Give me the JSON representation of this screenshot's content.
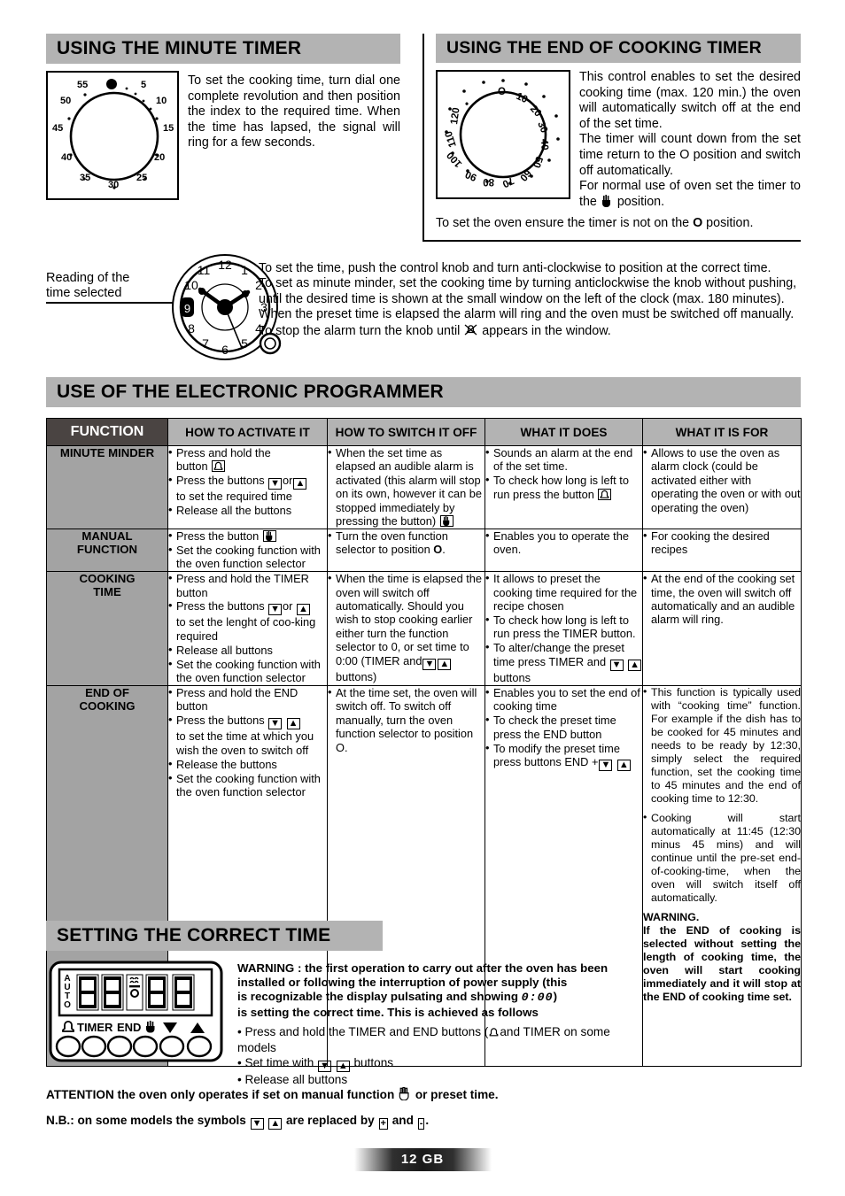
{
  "sections": {
    "minute_timer": {
      "title": "USING THE MINUTE TIMER",
      "text": "To set the cooking time, turn dial one complete revolution and then position the index to the required time. When the time has lapsed, the signal will ring for a few seconds.",
      "dial_labels": [
        "5",
        "10",
        "15",
        "20",
        "25",
        "30",
        "35",
        "40",
        "45",
        "50",
        "55"
      ]
    },
    "end_of_cooking_timer": {
      "title": "USING THE END OF COOKING TIMER",
      "paragraphs": [
        "This control enables to set the desired cooking time (max. 120 min.) the oven will automatically switch off at the end of the set time.",
        "The timer will count down from the set time return to the O position and switch off automatically.",
        "For normal use of oven set the timer to the \u0001 position."
      ],
      "p3_prefix": "For normal use of oven set the timer to",
      "p3_mid": "the",
      "p3_suffix": "position.",
      "footer_note_a": "To set the oven ensure the timer is not on the ",
      "footer_note_o": "O",
      "footer_note_b": " position.",
      "dial_labels": [
        "O",
        "10",
        "20",
        "30",
        "40",
        "50",
        "60",
        "70",
        "80",
        "90",
        "100",
        "110",
        "120"
      ]
    },
    "clock": {
      "caption_line1": "Reading of the",
      "caption_line2": "time selected",
      "numerals": [
        "12",
        "1",
        "2",
        "3",
        "4",
        "5",
        "6",
        "7",
        "8",
        "9",
        "10",
        "11"
      ],
      "window_value": "9",
      "lines": [
        "To set the time, push the control knob and turn anti-clockwise to position at the correct time.",
        "To set as minute minder, set the cooking time by turning anticlockwise the knob without pushing,",
        "until the desired time is shown at the small window on the left of the clock (max. 180 minutes).",
        "When the preset time is elapsed the alarm will ring and the oven must be switched off manually."
      ],
      "last_line_a": "To stop the alarm turn the knob until",
      "last_line_b": "appears in the window."
    }
  },
  "programmer": {
    "title": "USE OF THE ELECTRONIC PROGRAMMER",
    "columns": [
      "FUNCTION",
      "HOW TO ACTIVATE IT",
      "HOW TO SWITCH IT OFF",
      "WHAT IT DOES",
      "WHAT IT IS FOR"
    ],
    "rows": [
      {
        "name": "MINUTE MINDER",
        "activate": [
          "Press and hold the button ⌂",
          "Press the buttons ▼ or ▲ to set the required time",
          "Release all the buttons"
        ],
        "activate_parts": [
          [
            "Press and hold the",
            "button",
            "BELL"
          ],
          [
            "Press the buttons",
            "DOWN",
            "or",
            "UP",
            "to set the required time"
          ],
          [
            "Release all the buttons"
          ]
        ],
        "switch_off": [
          "When the set time as elapsed an audible alarm is activated (this alarm will stop on its own, however it can be stopped immediately by pressing the button) ✋"
        ],
        "does": [
          "Sounds an alarm at the end of the set time.",
          "To check how long is left to run press the button ⌂"
        ],
        "for": [
          "Allows to use the oven as alarm clock (could be activated either with operating the oven or with out operating the oven)"
        ]
      },
      {
        "name": "MANUAL FUNCTION",
        "name_line1": "MANUAL",
        "name_line2": "FUNCTION",
        "activate": [
          "Press the button ✋",
          "Set the cooking function with the oven function selector"
        ],
        "switch_off": [
          "Turn the oven function selector to position O."
        ],
        "does": [
          "Enables you to operate the oven."
        ],
        "for": [
          "For cooking the desired recipes"
        ]
      },
      {
        "name": "COOKING TIME",
        "name_line1": "COOKING",
        "name_line2": "TIME",
        "activate": [
          "Press and hold the TIMER button",
          "Press the buttons ▼ or ▲ to set the lenght of coo-king required",
          "Release all buttons",
          "Set the cooking function with the oven function selector"
        ],
        "switch_off": [
          "When the time is elapsed the oven will switch off automatically. Should you wish to stop cooking earlier either turn the function selector to 0, or set time to 0:00 (TIMER and ▼ ▲ buttons)"
        ],
        "does": [
          "It allows to preset the cooking time required for the recipe chosen",
          "To check how long is left to run press the TIMER button.",
          "To alter/change the preset time press TIMER and ▼ ▲ buttons"
        ],
        "for": [
          "At the end of the cooking set time, the oven will switch off automatically and an audible alarm will ring."
        ]
      },
      {
        "name": "END OF COOKING",
        "name_line1": "END OF",
        "name_line2": "COOKING",
        "activate": [
          "Press and hold the END button",
          "Press the buttons ▼ ▲ to set the time at which you wish the oven to switch off",
          "Release the buttons",
          "Set the cooking function with the oven function selector"
        ],
        "switch_off": [
          "At the time set, the oven will switch off. To switch off manually, turn the oven function selector to position O."
        ],
        "does": [
          "Enables you to set the end of cooking time",
          "To check the preset time press the END button",
          "To modify the preset time press buttons END + ▼ ▲"
        ],
        "for": [
          "This function is  typically used with “cooking time” function. For example if the dish has to be cooked for 45 minutes and needs to be ready by 12:30, simply select the required function, set the cooking time to 45 minutes and the end of cooking time to 12:30.",
          "Cooking will start automatically at 11:45 (12:30 minus 45 mins) and will continue until the pre-set end-of-cooking-time, when the oven will switch itself off automatically."
        ],
        "for_warning_title": "WARNING.",
        "for_warning_body": "If the END of cooking is selected without setting the length of cooking time, the oven will start cooking immediately and it will stop at the END of cooking time set."
      }
    ]
  },
  "setting_time": {
    "title": "SETTING THE CORRECT TIME",
    "warning_lines": [
      "WARNING : the first operation to carry out after the oven has been",
      "installed or following the interruption of power supply (this",
      "is recognizable the display pulsating and showing 0:00 )",
      "is setting the correct time. This is achieved as follows"
    ],
    "warning_l3_a": "is recognizable the display pulsating and showing",
    "warning_l3_digits": "0:00",
    "warning_l3_b": ")",
    "steps": [
      "Press and hold the TIMER and END buttons (⌂ and TIMER on some models",
      "Set time with ▼ ▲ buttons",
      "Release all buttons"
    ],
    "step1_a": "Press and hold the TIMER and END buttons (",
    "step1_b": "and TIMER on some",
    "step1_c": "models",
    "step2_a": "Set time with",
    "step2_b": "buttons",
    "step3": "Release all buttons",
    "panel": {
      "auto_letters": [
        "A",
        "U",
        "T",
        "O"
      ],
      "digits": [
        "8",
        "8",
        "8",
        "8"
      ],
      "button_labels": [
        "TIMER",
        "END"
      ],
      "bell_icon": "bell-icon",
      "hand_icon": "hand-icon",
      "down_icon": "down-arrow-icon",
      "up_icon": "up-arrow-icon"
    }
  },
  "notes": {
    "attention_a": "ATTENTION the oven only operates if set on manual function",
    "attention_b": "or preset time.",
    "nb_a": "N.B.: on some models the symbols",
    "nb_b": "are replaced by",
    "nb_plus": "+",
    "nb_and": "and",
    "nb_minus": "-",
    "nb_end": "."
  },
  "footer": {
    "page_number": "12",
    "language_code": "GB"
  },
  "colors": {
    "bar_gray": "#b3b3b3",
    "function_header": "#4a4442",
    "row_label_gray": "#a3a3a3",
    "ink": "#000000"
  }
}
